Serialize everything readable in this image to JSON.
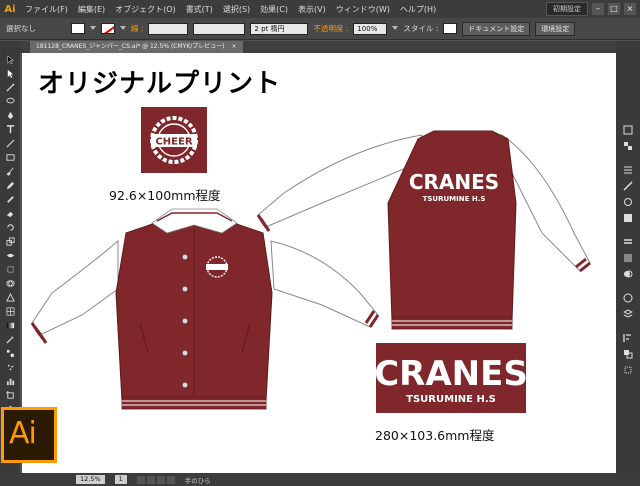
{
  "app": {
    "logo": "Ai",
    "menus": [
      "ファイル(F)",
      "編集(E)",
      "オブジェクト(O)",
      "書式(T)",
      "選択(S)",
      "効果(C)",
      "表示(V)",
      "ウィンドウ(W)",
      "ヘルプ(H)"
    ],
    "workspace": "初期設定",
    "win_min": "–",
    "win_max": "□",
    "win_close": "×"
  },
  "control": {
    "selection_label": "選択なし",
    "stroke_label": "線 :",
    "stroke_weight": "2 pt 楕円",
    "opacity_label": "不透明度 :",
    "opacity_value": "100%",
    "style_label": "スタイル :",
    "doc_setup_button": "ドキュメント設定",
    "env_setup_button": "環境設定"
  },
  "document": {
    "tab_label": "181128_CRANES_ジャンパー_CS.ai* @ 12.5% (CMYK/プレビュー)",
    "tab_close": "×"
  },
  "artboard": {
    "title": "オリジナルプリント",
    "logo_front_text": "CHEER",
    "logo_front_size": "92.6×100mm程度",
    "logo_back_main": "CRANES",
    "logo_back_sub": "TSURUMINE H.S",
    "logo_back_size": "280×103.6mm程度"
  },
  "status": {
    "zoom": "12.5%",
    "page": "1",
    "tool_name": "手のひら"
  },
  "colors": {
    "jacket_body": "#80272c",
    "sleeve": "#ffffff",
    "accent_ai": "#ff9a00"
  },
  "icons": {
    "ai_badge": "Ai"
  }
}
